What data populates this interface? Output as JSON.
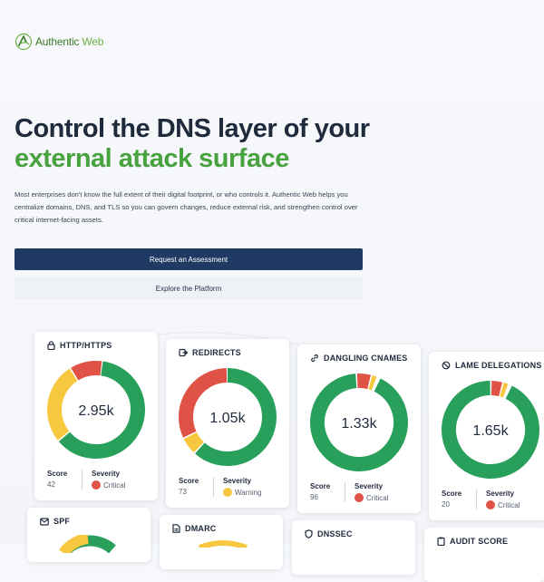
{
  "brand": {
    "name_part1": "Authentic",
    "name_part2": "Web"
  },
  "hero": {
    "title_line1": "Control the DNS layer of your",
    "title_line2": "external attack surface",
    "description": "Most enterprises don't know the full extent of their digital footprint, or who controls it. Authentic Web helps you centralize domains, DNS, and TLS so you can govern changes, reduce external risk, and strengthen control over critical internet-facing assets."
  },
  "actions": {
    "primary": "Request an Assessment",
    "secondary": "Explore the Platform"
  },
  "labels": {
    "score": "Score",
    "severity": "Severity"
  },
  "cards": [
    {
      "title": "HTTP/HTTPS",
      "icon": "lock-icon",
      "value": "2.95k",
      "score": "42",
      "severity": "Critical",
      "severity_color": "#e05246",
      "segments": [
        {
          "pct": 0.62,
          "color": "#28a05c"
        },
        {
          "pct": 0.27,
          "color": "#f7c83f"
        },
        {
          "pct": 0.11,
          "color": "#e05246"
        }
      ],
      "start_deg": 8
    },
    {
      "title": "REDIRECTS",
      "icon": "redirect-icon",
      "value": "1.05k",
      "score": "73",
      "severity": "Warning",
      "severity_color": "#f7c83f",
      "segments": [
        {
          "pct": 0.62,
          "color": "#28a05c"
        },
        {
          "pct": 0.06,
          "color": "#f7c83f"
        },
        {
          "pct": 0.32,
          "color": "#e05246"
        }
      ],
      "start_deg": 0
    },
    {
      "title": "DANGLING CNAMES",
      "icon": "link-icon",
      "value": "1.33k",
      "score": "96",
      "severity": "Critical",
      "severity_color": "#e05246",
      "segments": [
        {
          "pct": 0.92,
          "color": "#28a05c"
        },
        {
          "pct": 0.05,
          "color": "#e05246"
        },
        {
          "pct": 0.02,
          "color": "#f7c83f"
        }
      ],
      "start_deg": 26
    },
    {
      "title": "LAME DELEGATIONS",
      "icon": "ban-icon",
      "value": "1.65k",
      "score": "20",
      "severity": "Critical",
      "severity_color": "#e05246",
      "segments": [
        {
          "pct": 0.93,
          "color": "#28a05c"
        },
        {
          "pct": 0.04,
          "color": "#e05246"
        },
        {
          "pct": 0.02,
          "color": "#f7c83f"
        }
      ],
      "start_deg": 26
    },
    {
      "title": "SPF",
      "icon": "mail-icon"
    },
    {
      "title": "DMARC",
      "icon": "document-icon"
    },
    {
      "title": "DNSSEC",
      "icon": "shield-icon"
    },
    {
      "title": "AUDIT SCORE",
      "icon": "clipboard-icon"
    }
  ]
}
